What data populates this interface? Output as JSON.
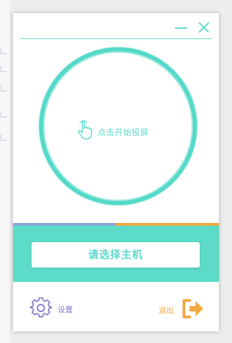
{
  "window": {
    "minimize_icon": "minimize-icon",
    "close_icon": "close-icon"
  },
  "cast": {
    "label": "点击开始投屏",
    "icon": "hand-pointer-icon"
  },
  "progress": {
    "fraction": 0.5
  },
  "select_host": {
    "label": "请选择主机"
  },
  "settings": {
    "label": "设置",
    "icon": "gear-icon"
  },
  "logout": {
    "label": "退出",
    "icon": "exit-icon"
  },
  "colors": {
    "accent": "#5fd8c9",
    "panel": "#5ddbc9",
    "settings": "#8a79c8",
    "logout": "#f4a841",
    "progress_left": "#8aa6d6"
  }
}
